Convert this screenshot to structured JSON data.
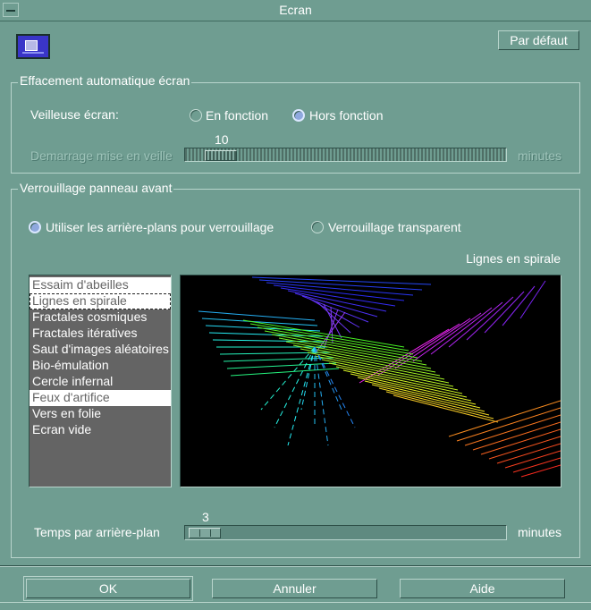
{
  "window": {
    "title": "Ecran"
  },
  "toolbar": {
    "default_label": "Par défaut"
  },
  "screen_blank": {
    "group_title": "Effacement automatique écran",
    "saver_label": "Veilleuse écran:",
    "option_on": "En fonction",
    "option_off": "Hors fonction",
    "selected_option": "Hors fonction",
    "start_label": "Demarrage mise en veille",
    "start_value": "10",
    "start_unit": "minutes"
  },
  "lock": {
    "group_title": "Verrouillage panneau avant",
    "option_backgrounds": "Utiliser les arrière-plans pour verrouillage",
    "option_transparent": "Verrouillage transparent",
    "selected_option": "Utiliser les arrière-plans pour verrouillage",
    "preview_title": "Lignes en spirale",
    "backgrounds": [
      {
        "label": "Essaim d'abeilles",
        "state": "selected"
      },
      {
        "label": "Lignes en spirale",
        "state": "focused"
      },
      {
        "label": "Fractales cosmiques",
        "state": "normal"
      },
      {
        "label": "Fractales itératives",
        "state": "normal"
      },
      {
        "label": "Saut d'images aléatoires",
        "state": "normal"
      },
      {
        "label": "Bio-émulation",
        "state": "normal"
      },
      {
        "label": "Cercle infernal",
        "state": "normal"
      },
      {
        "label": "Feux d'artifice",
        "state": "selected"
      },
      {
        "label": "Vers en folie",
        "state": "normal"
      },
      {
        "label": "Ecran vide",
        "state": "normal"
      }
    ],
    "time_label": "Temps par arrière-plan",
    "time_value": "3",
    "time_unit": "minutes"
  },
  "footer": {
    "ok_label": "OK",
    "cancel_label": "Annuler",
    "help_label": "Aide"
  },
  "colors": {
    "background": "#6f9d91",
    "list_bg": "#646464",
    "preview_bg": "#000000"
  }
}
